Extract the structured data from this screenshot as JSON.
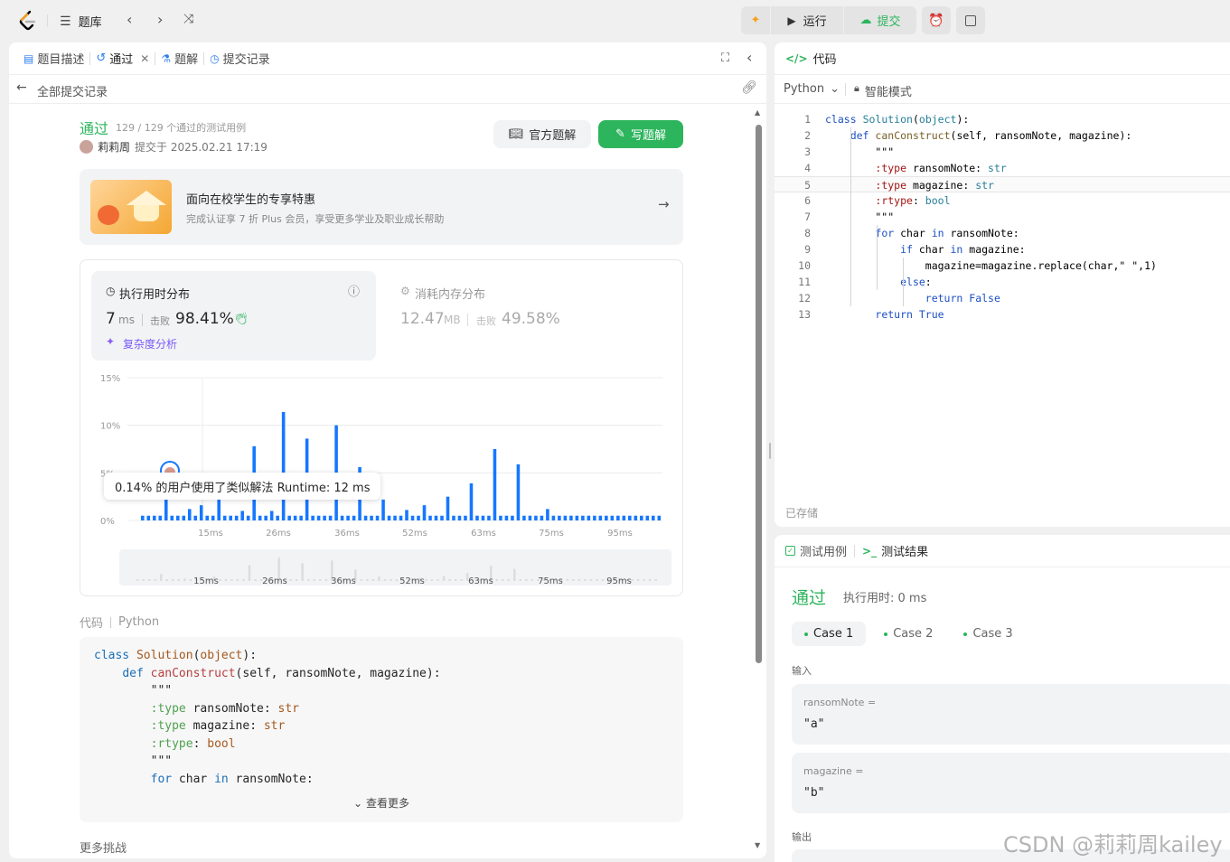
{
  "topbar": {
    "problem_bank": "题库",
    "run": "运行",
    "submit": "提交"
  },
  "left_tabs": {
    "description": "题目描述",
    "accepted": "通过",
    "solutions": "题解",
    "submissions": "提交记录"
  },
  "subnav": {
    "back_label": "全部提交记录"
  },
  "result": {
    "status": "通过",
    "testcases": "129 / 129 个通过的测试用例",
    "user": "莉莉周",
    "submitted": "提交于 2025.02.21 17:19",
    "official_btn": "官方题解",
    "write_btn": "写题解"
  },
  "promo": {
    "title": "面向在校学生的专享特惠",
    "desc": "完成认证享 7 折 Plus 会员，享受更多学业及职业成长帮助"
  },
  "runtime": {
    "title": "执行用时分布",
    "value": "7",
    "unit": "ms",
    "beats_label": "击败",
    "beats": "98.41%",
    "complexity": "复杂度分析"
  },
  "memory": {
    "title": "消耗内存分布",
    "value": "12.47",
    "unit": "MB",
    "beats_label": "击败",
    "beats": "49.58%"
  },
  "chart_data": {
    "type": "bar",
    "ylim": [
      0,
      15
    ],
    "y_ticks": [
      "15%",
      "10%",
      "5%",
      "0%"
    ],
    "x_ticks": [
      "15ms",
      "26ms",
      "36ms",
      "52ms",
      "63ms",
      "75ms",
      "95ms"
    ],
    "values": [
      0.5,
      0.5,
      0.5,
      0.5,
      3.4,
      0.5,
      0.5,
      0.5,
      1.2,
      0.5,
      1.6,
      0.5,
      0.5,
      2.2,
      0.5,
      0.5,
      0.5,
      1.0,
      0.5,
      7.8,
      0.5,
      0.5,
      1.0,
      0.5,
      11.4,
      0.5,
      0.5,
      0.5,
      8.6,
      0.5,
      0.5,
      0.5,
      0.5,
      10.0,
      0.5,
      0.5,
      0.5,
      5.6,
      0.5,
      0.5,
      0.5,
      2.2,
      0.5,
      0.5,
      0.5,
      1.1,
      0.5,
      0.5,
      1.6,
      0.5,
      0.5,
      0.5,
      2.5,
      0.5,
      0.5,
      0.5,
      3.9,
      0.5,
      0.5,
      0.5,
      7.5,
      0.5,
      0.5,
      0.5,
      5.9,
      0.5,
      0.5,
      0.5,
      0.5,
      1.2,
      0.5,
      0.5,
      0.5,
      0.5,
      0.5,
      0.5,
      0.5,
      0.5,
      0.5,
      0.5,
      0.5,
      0.5,
      0.5,
      0.5,
      0.5,
      0.5,
      0.5,
      0.5,
      0.5
    ],
    "tooltip": "0.14% 的用户使用了类似解法 Runtime: 12 ms",
    "grid": true
  },
  "code_meta": {
    "label": "代码",
    "lang": "Python",
    "more": "查看更多"
  },
  "submitted_code": [
    "class Solution(object):",
    "    def canConstruct(self, ransomNote, magazine):",
    "        \"\"\"",
    "        :type ransomNote: str",
    "        :type magazine: str",
    "        :rtype: bool",
    "        \"\"\"",
    "        for char in ransomNote:"
  ],
  "more_challenges": "更多挑战",
  "editor": {
    "title": "代码",
    "lang": "Python",
    "mode": "智能模式",
    "saved": "已存储",
    "lines": [
      "class Solution(object):",
      "    def canConstruct(self, ransomNote, magazine):",
      "        \"\"\"",
      "        :type ransomNote: str",
      "        :type magazine: str",
      "        :rtype: bool",
      "        \"\"\"",
      "        for char in ransomNote:",
      "            if char in magazine:",
      "                magazine=magazine.replace(char,\" \",1)",
      "            else:",
      "                return False",
      "        return True"
    ]
  },
  "testpanel": {
    "tab_cases": "测试用例",
    "tab_result": "测试结果",
    "status": "通过",
    "runtime": "执行用时: 0 ms",
    "cases": [
      "Case 1",
      "Case 2",
      "Case 3"
    ],
    "input_label": "输入",
    "ransom_label": "ransomNote =",
    "ransom_value": "\"a\"",
    "magazine_label": "magazine =",
    "magazine_value": "\"b\"",
    "output_label": "输出"
  },
  "watermark": "CSDN @莉莉周kailey",
  "colors": {
    "green": "#2db55d",
    "blue_bar": "#1677ff",
    "accent_text": "#2db55d"
  }
}
